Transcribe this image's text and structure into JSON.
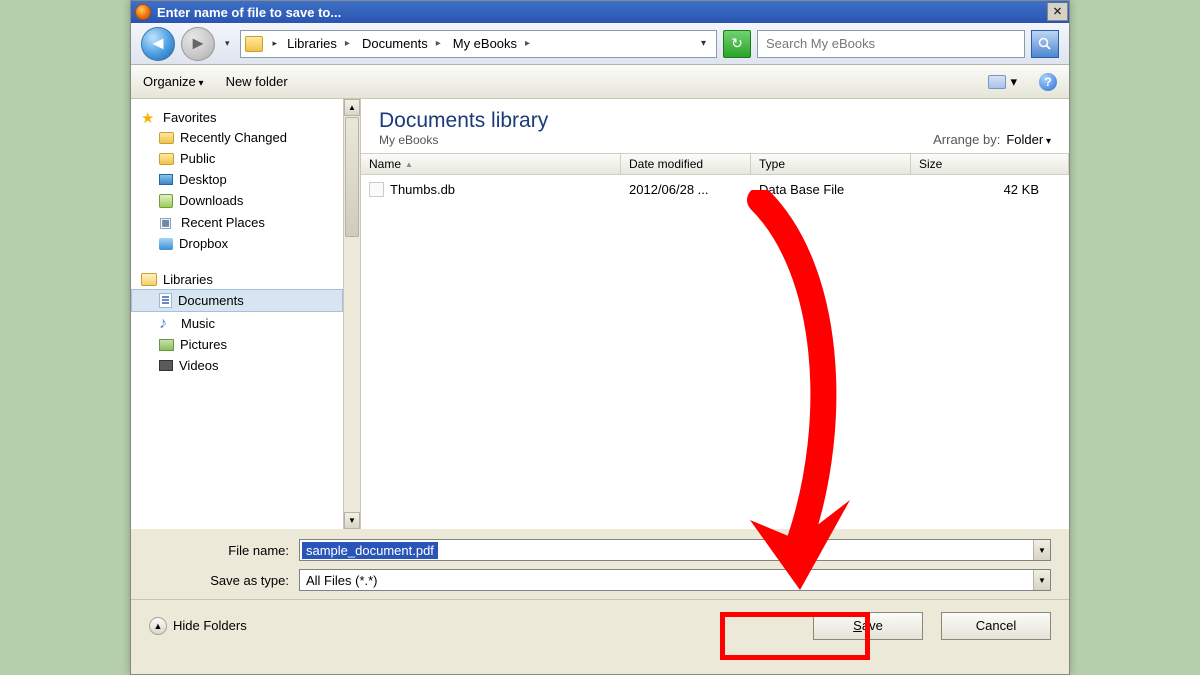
{
  "titlebar": {
    "title": "Enter name of file to save to..."
  },
  "nav": {
    "breadcrumb": {
      "seg1": "Libraries",
      "seg2": "Documents",
      "seg3": "My eBooks"
    },
    "search_placeholder": "Search My eBooks"
  },
  "toolbar": {
    "organize": "Organize",
    "new_folder": "New folder"
  },
  "sidebar": {
    "favorites": {
      "label": "Favorites",
      "items": {
        "recent": "Recently Changed",
        "public": "Public",
        "desktop": "Desktop",
        "downloads": "Downloads",
        "places": "Recent Places",
        "dropbox": "Dropbox"
      }
    },
    "libraries": {
      "label": "Libraries",
      "items": {
        "documents": "Documents",
        "music": "Music",
        "pictures": "Pictures",
        "videos": "Videos"
      }
    }
  },
  "main": {
    "lib_title": "Documents library",
    "lib_sub": "My eBooks",
    "arrange_label": "Arrange by:",
    "arrange_value": "Folder",
    "columns": {
      "name": "Name",
      "date": "Date modified",
      "type": "Type",
      "size": "Size"
    },
    "file": {
      "name": "Thumbs.db",
      "date": "2012/06/28 ...",
      "type": "Data Base File",
      "size": "42 KB"
    }
  },
  "form": {
    "file_name_label": "File name:",
    "file_name_value": "sample_document.pdf",
    "save_type_label": "Save as type:",
    "save_type_value": "All Files (*.*)"
  },
  "footer": {
    "hide_folders": "Hide Folders",
    "save": "ave",
    "save_prefix": "S",
    "cancel": "Cancel"
  }
}
